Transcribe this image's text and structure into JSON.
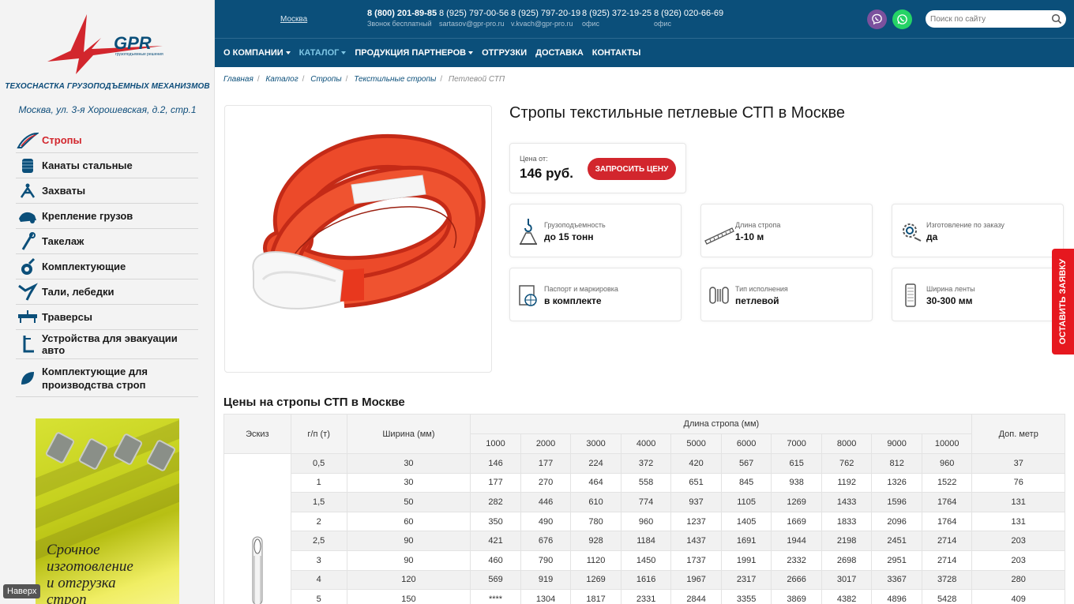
{
  "sidebar": {
    "logo_text": "GPR",
    "logo_subtext": "грузоподъемные решения",
    "tagline": "ТЕХОСНАСТКА ГРУЗОПОДЪЕМНЫХ МЕХАНИЗМОВ",
    "address": "Москва, ул. 3-я Хорошевская, д.2, стр.1",
    "menu": [
      {
        "label": "Стропы",
        "icon": "sling-icon"
      },
      {
        "label": "Канаты стальные",
        "icon": "cable-spool-icon"
      },
      {
        "label": "Захваты",
        "icon": "grip-icon"
      },
      {
        "label": "Крепление грузов",
        "icon": "cargo-icon"
      },
      {
        "label": "Такелаж",
        "icon": "rigging-icon"
      },
      {
        "label": "Комплектующие",
        "icon": "hook-icon"
      },
      {
        "label": "Тали, лебедки",
        "icon": "hoist-icon"
      },
      {
        "label": "Траверсы",
        "icon": "traverse-icon"
      },
      {
        "label": "Устройства для эвакуации авто",
        "icon": "tow-icon"
      },
      {
        "label": "Комплектующие для производства строп",
        "icon": "parts-icon"
      }
    ],
    "promo_text": [
      "Срочное",
      "изготовление",
      "и отгрузка",
      "строп"
    ],
    "back_to_top": "Наверх"
  },
  "header": {
    "city": "Москва",
    "phones": [
      {
        "number": "8 (800) 201-89-85",
        "sub": "Звонок бесплатный",
        "bold": true
      },
      {
        "number": "8 (925) 797-00-56",
        "sub": "sartasov@gpr-pro.ru",
        "bold": false
      },
      {
        "number": "8 (925) 797-20-19",
        "sub": "v.kvach@gpr-pro.ru",
        "bold": false
      },
      {
        "number": "8 (925) 372-19-25",
        "sub": "офис",
        "bold": false
      },
      {
        "number": "8 (926) 020-66-69",
        "sub": "офис",
        "bold": false
      }
    ],
    "viber_color": "#7b519d",
    "whatsapp_color": "#25d366",
    "search_placeholder": "Поиск по сайту",
    "nav": [
      {
        "label": "О компании",
        "dropdown": true,
        "active": false
      },
      {
        "label": "Каталог",
        "dropdown": true,
        "active": true
      },
      {
        "label": "Продукция партнеров",
        "dropdown": true,
        "active": false
      },
      {
        "label": "Отгрузки",
        "dropdown": false,
        "active": false
      },
      {
        "label": "Доставка",
        "dropdown": false,
        "active": false
      },
      {
        "label": "Контакты",
        "dropdown": false,
        "active": false
      }
    ]
  },
  "breadcrumb": [
    "Главная",
    "Каталог",
    "Стропы",
    "Текстильные стропы",
    "Петлевой СТП"
  ],
  "product": {
    "title": "Стропы текстильные петлевые СТП в Москве",
    "price_label": "Цена от:",
    "price_value": "146 руб.",
    "price_button": "Запросить цену",
    "features": [
      {
        "label": "Грузоподъемность",
        "value": "до 15 тонн",
        "icon": "crane-hook-icon"
      },
      {
        "label": "Длина стропа",
        "value": "1-10 м",
        "icon": "ruler-icon"
      },
      {
        "label": "Изготовление по заказу",
        "value": "да",
        "icon": "gear-icon"
      },
      {
        "label": "Паспорт и маркировка",
        "value": "в комплекте",
        "icon": "passport-icon"
      },
      {
        "label": "Тип исполнения",
        "value": "петлевой",
        "icon": "loop-icon"
      },
      {
        "label": "Ширина ленты",
        "value": "30-300 мм",
        "icon": "tape-width-icon"
      }
    ],
    "colors": {
      "accent": "#d2262d",
      "brand": "#0b4f7a",
      "sling": "#e8381e"
    }
  },
  "side_tab": "Оставить заявку",
  "table": {
    "title": "Цены на стропы СТП в Москве",
    "headers": {
      "sketch": "Эскиз",
      "gp": "г/п (т)",
      "width": "Ширина (мм)",
      "length": "Длина стропа (мм)",
      "extra": "Доп. метр"
    },
    "lengths": [
      "1000",
      "2000",
      "3000",
      "4000",
      "5000",
      "6000",
      "7000",
      "8000",
      "9000",
      "10000"
    ],
    "rows": [
      [
        "0,5",
        "30",
        "146",
        "177",
        "224",
        "372",
        "420",
        "567",
        "615",
        "762",
        "812",
        "960",
        "37"
      ],
      [
        "1",
        "30",
        "177",
        "270",
        "464",
        "558",
        "651",
        "845",
        "938",
        "1192",
        "1326",
        "1522",
        "76"
      ],
      [
        "1,5",
        "50",
        "282",
        "446",
        "610",
        "774",
        "937",
        "1105",
        "1269",
        "1433",
        "1596",
        "1764",
        "131"
      ],
      [
        "2",
        "60",
        "350",
        "490",
        "780",
        "960",
        "1237",
        "1405",
        "1669",
        "1833",
        "2096",
        "1764",
        "131"
      ],
      [
        "2,5",
        "90",
        "421",
        "676",
        "928",
        "1184",
        "1437",
        "1691",
        "1944",
        "2198",
        "2451",
        "2714",
        "203"
      ],
      [
        "3",
        "90",
        "460",
        "790",
        "1120",
        "1450",
        "1737",
        "1991",
        "2332",
        "2698",
        "2951",
        "2714",
        "203"
      ],
      [
        "4",
        "120",
        "569",
        "919",
        "1269",
        "1616",
        "1967",
        "2317",
        "2666",
        "3017",
        "3367",
        "3728",
        "280"
      ],
      [
        "5",
        "150",
        "****",
        "1304",
        "1817",
        "2331",
        "2844",
        "3355",
        "3869",
        "4382",
        "4896",
        "5428",
        "409"
      ]
    ]
  }
}
